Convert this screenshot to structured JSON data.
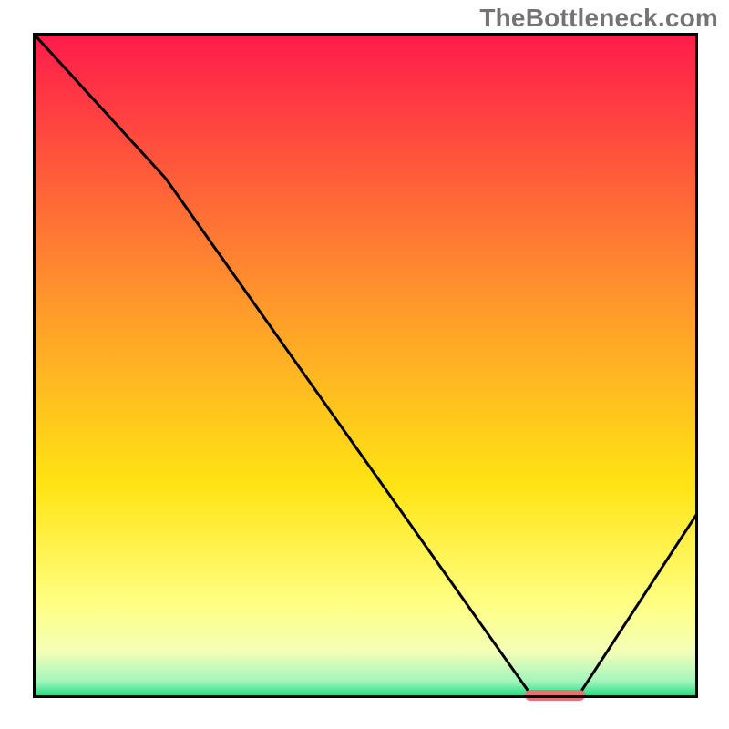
{
  "watermark": "TheBottleneck.com",
  "chart_data": {
    "type": "line",
    "title": "",
    "xlabel": "",
    "ylabel": "",
    "xlim": [
      0,
      100
    ],
    "ylim": [
      0,
      100
    ],
    "grid": false,
    "series": [
      {
        "name": "bottleneck-curve",
        "x": [
          0,
          20,
          75,
          82,
          100
        ],
        "y": [
          100,
          78,
          0,
          0,
          28
        ]
      }
    ],
    "annotations": [
      {
        "name": "optimal-range",
        "x_start": 74,
        "x_end": 83,
        "y": 0,
        "color": "#e57373"
      }
    ],
    "background": {
      "type": "vertical-gradient",
      "stops": [
        {
          "pos": 0.0,
          "color": "#ff1a4b"
        },
        {
          "pos": 0.42,
          "color": "#ff9c2a"
        },
        {
          "pos": 0.68,
          "color": "#ffe413"
        },
        {
          "pos": 0.86,
          "color": "#ffff84"
        },
        {
          "pos": 0.93,
          "color": "#f3ffb6"
        },
        {
          "pos": 0.975,
          "color": "#a3f5bd"
        },
        {
          "pos": 1.0,
          "color": "#10d977"
        }
      ]
    }
  },
  "marker": {
    "left_pct": 74,
    "width_pct": 9
  }
}
